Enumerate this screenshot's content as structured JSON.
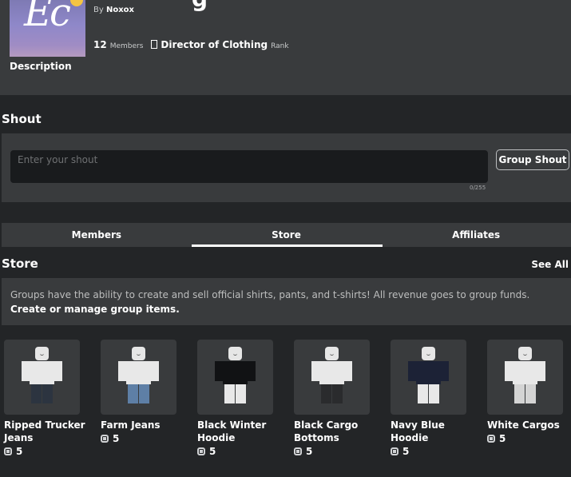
{
  "group": {
    "title_fragment": "g",
    "logo_text": "Ec",
    "by_label": "By",
    "owner": "Noxox",
    "members_count": "12",
    "members_label": "Members",
    "rank_name": "Director of Clothing",
    "rank_label": "Rank",
    "description_label": "Description"
  },
  "shout": {
    "title": "Shout",
    "placeholder": "Enter your shout",
    "char_count": "0/255",
    "button_label": "Group Shout"
  },
  "tabs": [
    {
      "label": "Members",
      "active": false
    },
    {
      "label": "Store",
      "active": true
    },
    {
      "label": "Affiliates",
      "active": false
    }
  ],
  "store": {
    "title": "Store",
    "see_all": "See All",
    "info_text": "Groups have the ability to create and sell official shirts, pants, and t-shirts! All revenue goes to group funds.",
    "manage_link": "Create or manage group items.",
    "items": [
      {
        "name": "Ripped Trucker Jeans",
        "price": "5",
        "torso": "#e8e8e8",
        "legs": "#2c3440"
      },
      {
        "name": "Farm Jeans",
        "price": "5",
        "torso": "#e8e8e8",
        "legs": "#5e7fa6"
      },
      {
        "name": "Black Winter Hoodie",
        "price": "5",
        "torso": "#111214",
        "legs": "#e8e8e8"
      },
      {
        "name": "Black Cargo Bottoms",
        "price": "5",
        "torso": "#e8e8e8",
        "legs": "#2a2b2d"
      },
      {
        "name": "Navy Blue Hoodie",
        "price": "5",
        "torso": "#1c2236",
        "legs": "#e8e8e8"
      },
      {
        "name": "White Cargos",
        "price": "5",
        "torso": "#e8e8e8",
        "legs": "#d4d4d4"
      }
    ]
  },
  "colors": {
    "page_bg": "#232527",
    "panel_bg": "#393b3d",
    "input_bg": "#191b1d"
  }
}
